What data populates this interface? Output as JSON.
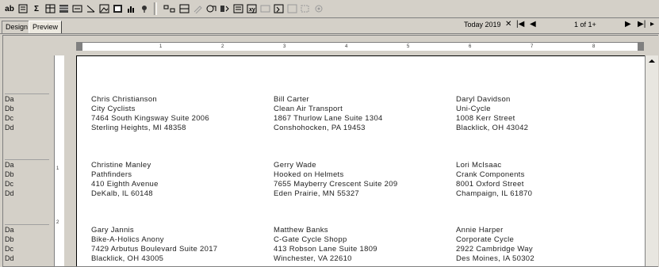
{
  "toolbar": {
    "items": [
      "ab",
      "Σ"
    ]
  },
  "tabs": {
    "design": "Design",
    "preview": "Preview"
  },
  "nav": {
    "today": "Today 2019",
    "page": "1 of 1+"
  },
  "ruler_numbers": [
    "1",
    "2",
    "3",
    "4",
    "5",
    "6",
    "7",
    "8"
  ],
  "field_labels": [
    "Da",
    "Db",
    "Dc",
    "Dd"
  ],
  "vruler_numbers": [
    "1",
    "2"
  ],
  "labels": [
    {
      "name": "Chris Christianson",
      "company": "City Cyclists",
      "street": "7464 South Kingsway  Suite 2006",
      "city": "Sterling Heights, MI 48358"
    },
    {
      "name": "Bill Carter",
      "company": "Clean Air Transport",
      "street": "1867 Thurlow Lane  Suite 1304",
      "city": "Conshohocken, PA 19453"
    },
    {
      "name": "Daryl Davidson",
      "company": "Uni-Cycle",
      "street": "1008 Kerr Street",
      "city": "Blacklick, OH 43042"
    },
    {
      "name": "Christine Manley",
      "company": "Pathfinders",
      "street": "410 Eighth Avenue",
      "city": "DeKalb, IL 60148"
    },
    {
      "name": "Gerry Wade",
      "company": "Hooked on Helmets",
      "street": "7655 Mayberry Crescent  Suite 209",
      "city": "Eden Prairie, MN 55327"
    },
    {
      "name": "Lori McIsaac",
      "company": "Crank Components",
      "street": "8001 Oxford Street",
      "city": "Champaign, IL 61870"
    },
    {
      "name": "Gary Jannis",
      "company": "Bike-A-Holics Anony",
      "street": "7429 Arbutus Boulevard  Suite 2017",
      "city": "Blacklick, OH 43005"
    },
    {
      "name": "Matthew Banks",
      "company": "C-Gate Cycle Shopp",
      "street": "413 Robson Lane  Suite 1809",
      "city": "Winchester, VA 22610"
    },
    {
      "name": "Annie Harper",
      "company": "Corporate Cycle",
      "street": "2922 Cambridge Way",
      "city": "Des Moines, IA 50302"
    }
  ]
}
